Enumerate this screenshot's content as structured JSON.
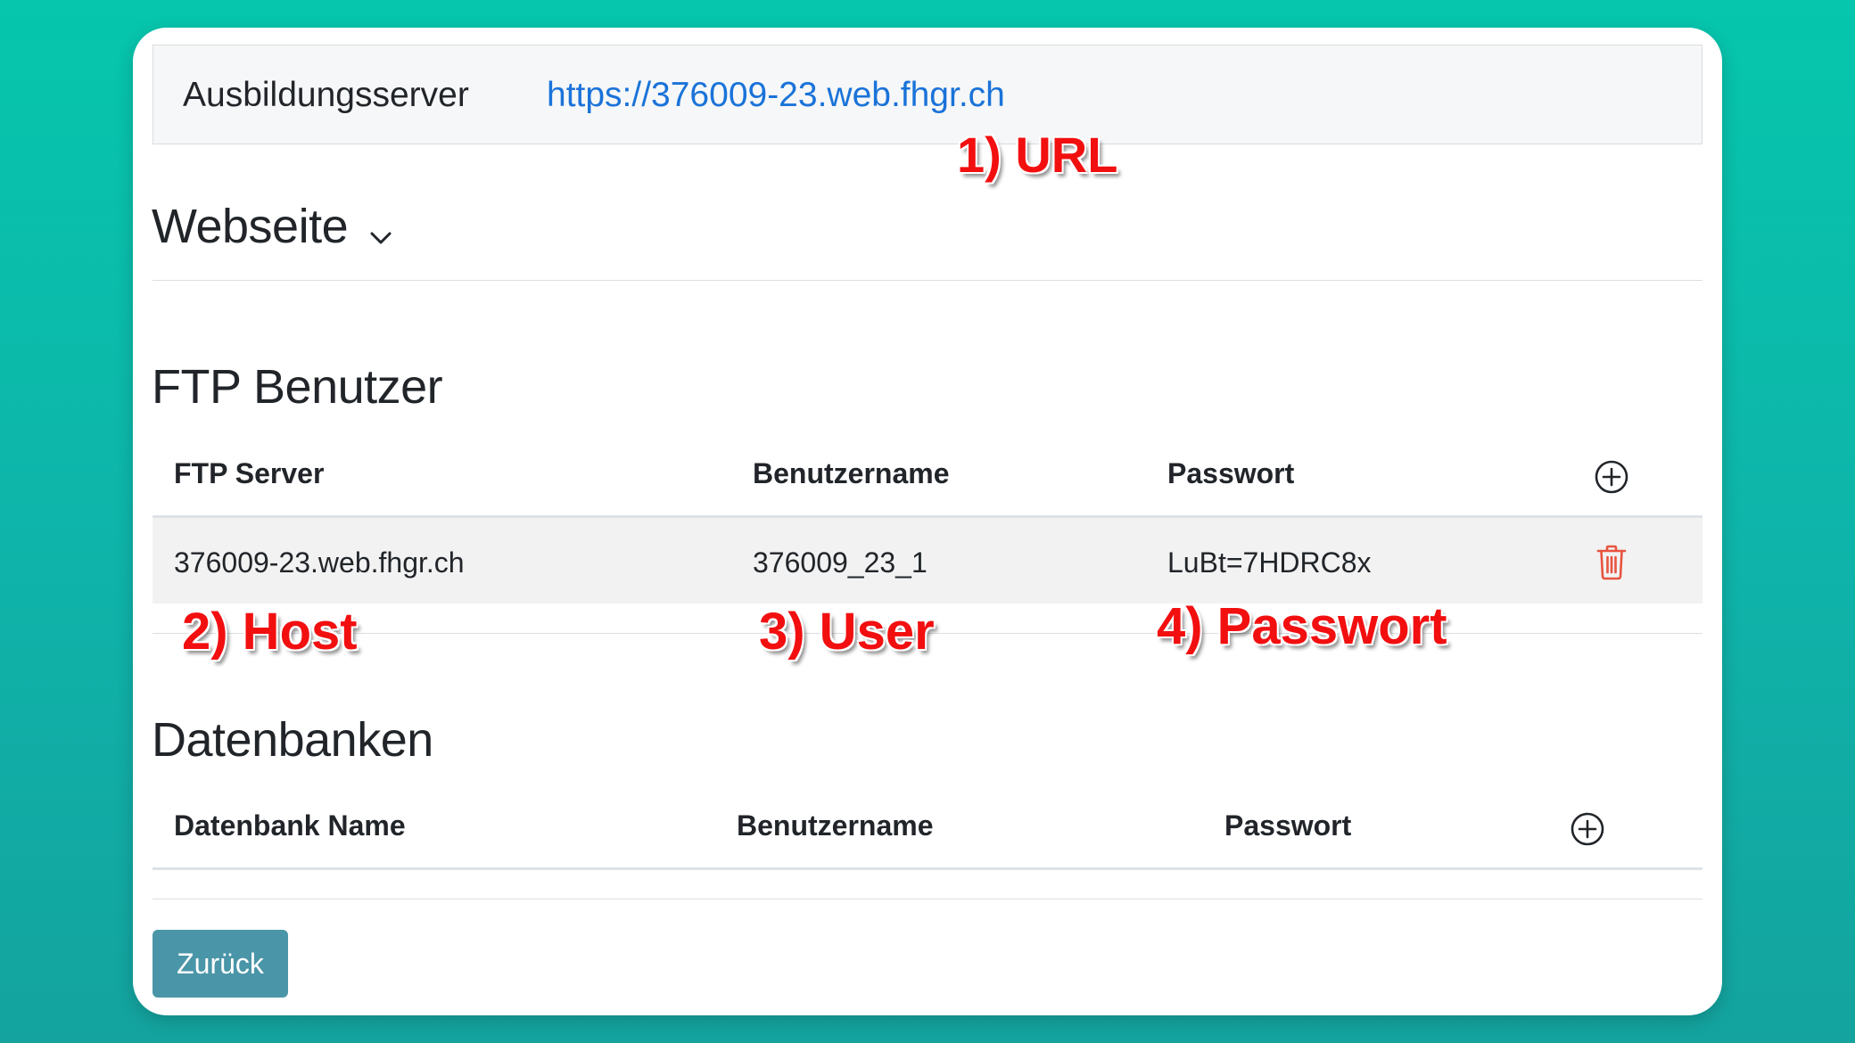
{
  "server": {
    "label": "Ausbildungsserver",
    "url": "https://376009-23.web.fhgr.ch"
  },
  "annotations": {
    "url": "1) URL",
    "host": "2) Host",
    "user": "3) User",
    "password": "4) Passwort"
  },
  "website": {
    "title": "Webseite",
    "toggle_icon": "chevron-down-icon"
  },
  "ftp": {
    "title": "FTP Benutzer",
    "columns": [
      "FTP Server",
      "Benutzername",
      "Passwort"
    ],
    "add_icon": "plus-circle-icon",
    "rows": [
      {
        "server": "376009-23.web.fhgr.ch",
        "username": "376009_23_1",
        "password": "LuBt=7HDRC8x",
        "delete_icon": "trash-icon"
      }
    ]
  },
  "databases": {
    "title": "Datenbanken",
    "columns": [
      "Datenbank Name",
      "Benutzername",
      "Passwort"
    ],
    "add_icon": "plus-circle-icon",
    "rows": []
  },
  "footer": {
    "back_label": "Zurück"
  },
  "colors": {
    "background": "#0fb3a9",
    "link": "#1a73d9",
    "annotation": "#f20f10",
    "back_button": "#4a95a8",
    "delete_icon": "#e8533f"
  }
}
